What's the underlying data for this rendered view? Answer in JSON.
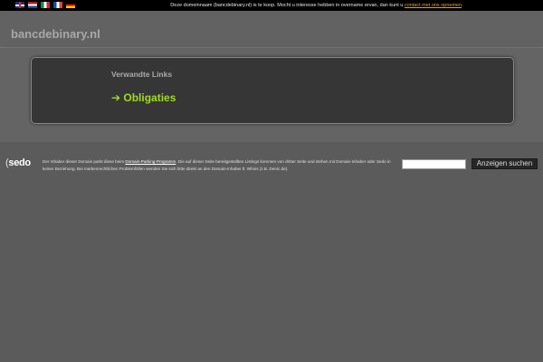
{
  "topbar": {
    "languages": [
      "English",
      "Nederlands",
      "Italiano",
      "Français",
      "Deutsch"
    ],
    "sale_notice_text": "Deze domeinnaam (bancdebinary.nl) is te koop. Mocht u interesse hebben in overname ervan, dan kunt u ",
    "contact_link": "contact met ons opnemen",
    "sale_notice_end": "."
  },
  "header": {
    "domain": "bancdebinary.nl"
  },
  "links_panel": {
    "heading": "Verwandte Links",
    "links": [
      {
        "label": "➔ Obligaties"
      }
    ],
    "link_color": "#9fdc22"
  },
  "footer": {
    "logo": "sedo",
    "disclaimer_start": "Der Inhaber dieser Domain parkt diese beim ",
    "disclaimer_link": "Domain-Parking-Programm",
    "disclaimer_end": ". Die auf dieser Seite bereitgestellten Listings kommen von dritter Seite und stehen mit Domain-Inhaber oder Sedo in keiner Beziehung. Bei markenrechtlichen Problemfällen wenden Sie sich bitte direkt an den Domain-Inhaber lt. Whois (z.B. Denic.de).",
    "search_placeholder": "",
    "search_button": "Anzeigen suchen"
  },
  "colors": {
    "background": "#5a5a5a",
    "panel": "#363636",
    "accent_link": "#9fdc22",
    "contact_link": "#f39c1e"
  }
}
